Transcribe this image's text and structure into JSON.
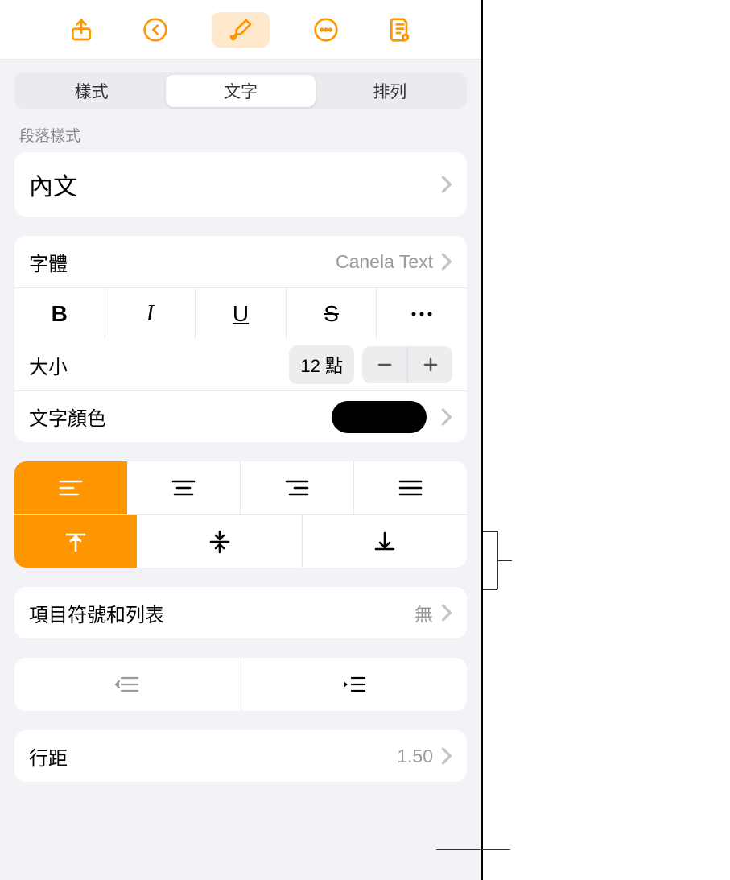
{
  "tabs": {
    "style": "樣式",
    "text": "文字",
    "arrange": "排列"
  },
  "sections": {
    "paragraph_style_label": "段落樣式",
    "paragraph_style_value": "內文"
  },
  "font": {
    "label": "字體",
    "value": "Canela Text"
  },
  "size": {
    "label": "大小",
    "value": "12 點"
  },
  "text_color": {
    "label": "文字顏色",
    "value_hex": "#000000"
  },
  "bullets": {
    "label": "項目符號和列表",
    "value": "無"
  },
  "line_spacing": {
    "label": "行距",
    "value": "1.50"
  },
  "style_buttons": {
    "bold": "B",
    "italic": "I",
    "underline": "U",
    "strike": "S"
  }
}
